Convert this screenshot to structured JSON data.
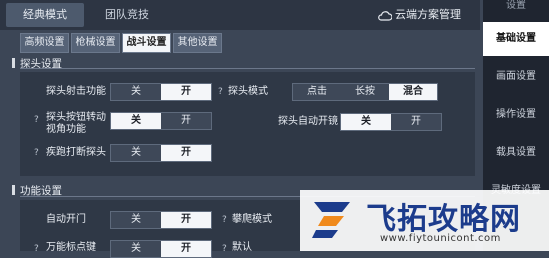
{
  "mode_tabs": [
    "经典模式",
    "团队竞技"
  ],
  "cloud_manage": "云端方案管理",
  "sub_tabs": [
    "高频设置",
    "枪械设置",
    "战斗设置",
    "其他设置"
  ],
  "peek": {
    "title": "探头设置",
    "fire": {
      "label": "探头射击功能",
      "off": "关",
      "on": "开"
    },
    "mode": {
      "label": "探头模式",
      "options": [
        "点击",
        "长按",
        "混合"
      ]
    },
    "rotate": {
      "label_line1": "探头按钮转动",
      "label_line2": "视角功能",
      "off": "关",
      "on": "开"
    },
    "auto_scope": {
      "label": "探头自动开镜",
      "off": "关",
      "on": "开"
    },
    "sprint": {
      "label": "疾跑打断探头",
      "off": "关",
      "on": "开"
    }
  },
  "func": {
    "title": "功能设置",
    "auto_door": {
      "label": "自动开门",
      "off": "关",
      "on": "开"
    },
    "climb": {
      "label": "攀爬模式"
    },
    "universal": {
      "label": "万能标点键",
      "off": "关",
      "on": "开"
    },
    "partial": "默认"
  },
  "help_mark": "?",
  "sidebar": [
    "设置",
    "基础设置",
    "画面设置",
    "操作设置",
    "载具设置",
    "灵敏度设置"
  ],
  "watermark": {
    "text": "飞拓攻略网",
    "url": "www.fiytounicont.com"
  },
  "colors": {
    "panel": "#2f3846",
    "selected": "#f4f6f9",
    "watermark_blue": "#1c3c8c"
  }
}
